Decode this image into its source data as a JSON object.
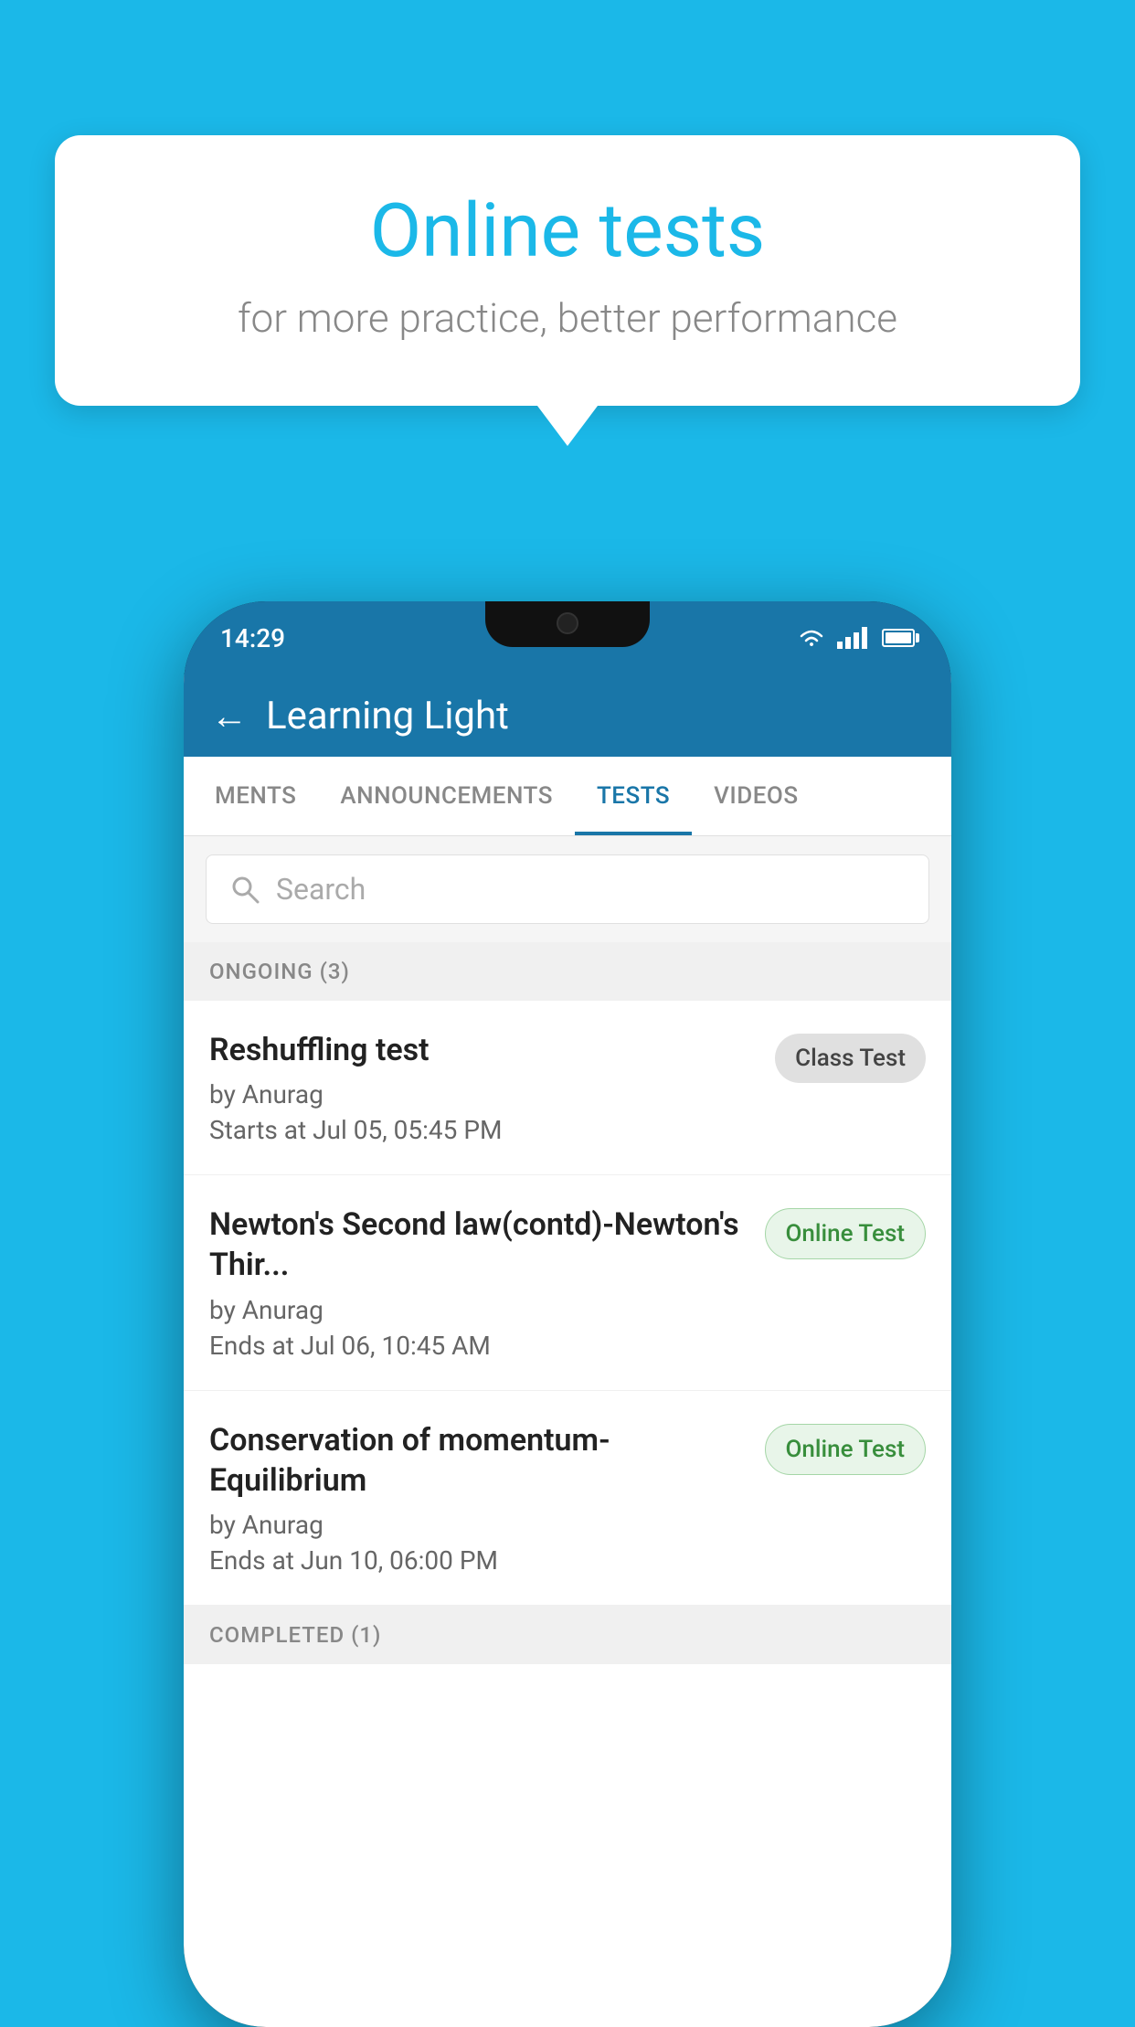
{
  "background_color": "#1bb8e8",
  "bubble": {
    "title": "Online tests",
    "subtitle": "for more practice, better performance"
  },
  "status_bar": {
    "time": "14:29"
  },
  "app": {
    "title": "Learning Light",
    "back_label": "←"
  },
  "tabs": [
    {
      "label": "MENTS",
      "active": false
    },
    {
      "label": "ANNOUNCEMENTS",
      "active": false
    },
    {
      "label": "TESTS",
      "active": true
    },
    {
      "label": "VIDEOS",
      "active": false
    }
  ],
  "search": {
    "placeholder": "Search"
  },
  "ongoing_section": {
    "label": "ONGOING (3)"
  },
  "tests": [
    {
      "name": "Reshuffling test",
      "by": "by Anurag",
      "time_label": "Starts at",
      "time": "Jul 05, 05:45 PM",
      "badge": "Class Test",
      "badge_type": "class"
    },
    {
      "name": "Newton's Second law(contd)-Newton's Thir...",
      "by": "by Anurag",
      "time_label": "Ends at",
      "time": "Jul 06, 10:45 AM",
      "badge": "Online Test",
      "badge_type": "online"
    },
    {
      "name": "Conservation of momentum-Equilibrium",
      "by": "by Anurag",
      "time_label": "Ends at",
      "time": "Jun 10, 06:00 PM",
      "badge": "Online Test",
      "badge_type": "online"
    }
  ],
  "completed_section": {
    "label": "COMPLETED (1)"
  }
}
